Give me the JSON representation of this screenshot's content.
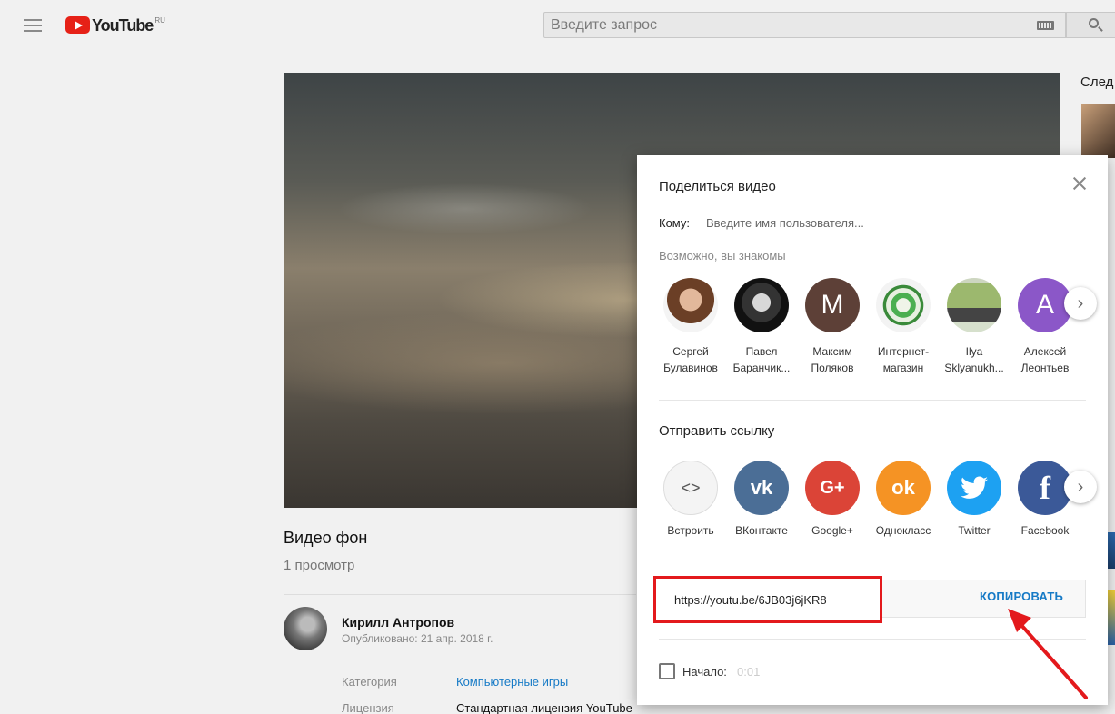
{
  "header": {
    "logo_text": "YouTube",
    "logo_region": "RU",
    "search_placeholder": "Введите запрос"
  },
  "video": {
    "title": "Видео фон",
    "views": "1 просмотр",
    "channel": "Кирилл Антропов",
    "published": "Опубликовано: 21 апр. 2018 г.",
    "meta": [
      {
        "label": "Категория",
        "value": "Компьютерные игры"
      },
      {
        "label": "Лицензия",
        "value": "Стандартная лицензия YouTube"
      }
    ]
  },
  "sidebar": {
    "next_label": "След"
  },
  "share_dialog": {
    "title": "Поделиться видео",
    "to_label": "Кому:",
    "to_placeholder": "Введите имя пользователя...",
    "suggested_label": "Возможно, вы знакомы",
    "contacts": [
      {
        "name": "Сергей Булавинов",
        "initial": ""
      },
      {
        "name": "Павел Баранчик...",
        "initial": ""
      },
      {
        "name": "Максим Поляков",
        "initial": "M",
        "color": "#5d4037"
      },
      {
        "name": "Интернет-магазин",
        "initial": ""
      },
      {
        "name": "Ilya Sklyanukh...",
        "initial": ""
      },
      {
        "name": "Алексей Леонтьев",
        "initial": "A",
        "color": "#8b57c8"
      }
    ],
    "send_link_label": "Отправить ссылку",
    "services": [
      {
        "name": "Встроить",
        "icon": "embed-icon",
        "symbol": "<>",
        "color": "#f4f4f4"
      },
      {
        "name": "ВКонтакте",
        "icon": "vk-icon",
        "symbol": "vk",
        "color": "#4b6e96"
      },
      {
        "name": "Google+",
        "icon": "google-plus-icon",
        "symbol": "G+",
        "color": "#db4437"
      },
      {
        "name": "Однокласс",
        "icon": "odnoklassniki-icon",
        "symbol": "ok",
        "color": "#f59324"
      },
      {
        "name": "Twitter",
        "icon": "twitter-icon",
        "symbol": "t",
        "color": "#1da1f2"
      },
      {
        "name": "Facebook",
        "icon": "facebook-icon",
        "symbol": "f",
        "color": "#3b5998"
      }
    ],
    "url": "https://youtu.be/6JB03j6jKR8",
    "copy_label": "КОПИРОВАТЬ",
    "start_label": "Начало:",
    "start_time": "0:01",
    "highlight_color": "#e3191c"
  }
}
